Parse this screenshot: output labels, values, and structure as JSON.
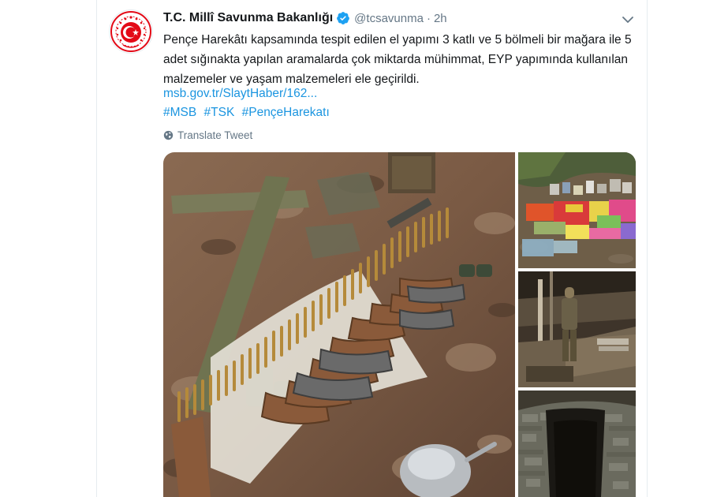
{
  "tweet": {
    "author_name": "T.C. Millî Savunma Bakanlığı",
    "handle": "@tcsavunma",
    "separator": "·",
    "time": "2h",
    "text": "Pençe Harekâtı kapsamında tespit edilen el yapımı 3 katlı ve 5 bölmeli bir mağara ile 5 adet sığınakta yapılan aramalarda çok miktarda mühimmat, EYP yapımında kullanılan malzemeler ve yaşam malzemeleri ele geçirildi.",
    "link": "msb.gov.tr/SlaytHaber/162...",
    "hashtags": [
      "#MSB",
      "#TSK",
      "#PençeHarekatı"
    ],
    "translate_label": "Translate Tweet"
  },
  "icons": {
    "avatar": "ministry-seal-icon",
    "verified": "verified-badge-icon",
    "caret": "chevron-down-icon",
    "translate": "globe-icon"
  },
  "colors": {
    "link": "#1b95e0",
    "secondary_text": "#657786",
    "verified": "#1da1f2",
    "seal_red": "#e30a17"
  }
}
